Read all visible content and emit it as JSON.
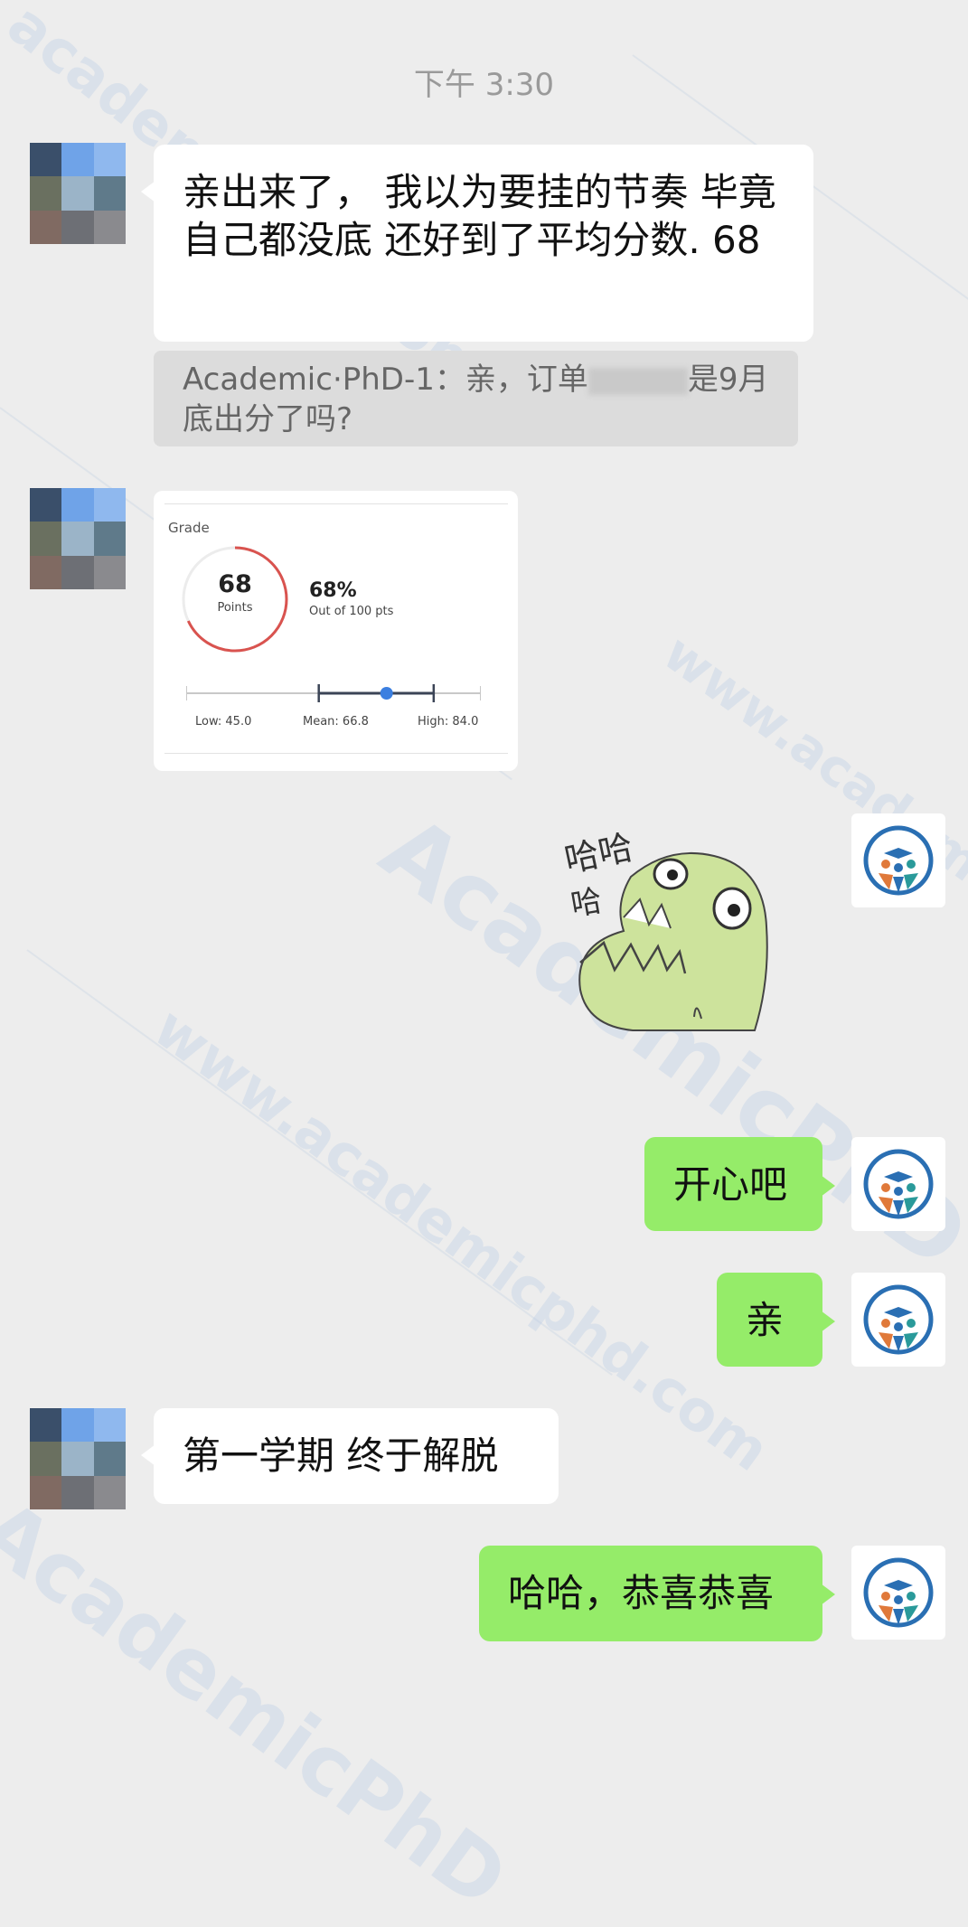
{
  "timestamp": "下午 3:30",
  "watermark": {
    "text_a": "academicphd.com",
    "text_b": "www.academicphd.com",
    "text_c": "AcademicPhD"
  },
  "colors": {
    "green_bubble": "#95ec69",
    "background": "#ededed",
    "ring_red": "#d9534f",
    "slider_dot": "#3b7fe0"
  },
  "messages": [
    {
      "sender": "other",
      "text": "亲出来了， 我以为要挂的节奏 毕竟自己都没底 还好到了平均分数. 68"
    },
    {
      "sender": "other",
      "quote_prefix": "Academic·PhD-1：亲，订单",
      "quote_suffix": "是9月底出分了吗?"
    },
    {
      "sender": "other",
      "type": "grade_card"
    },
    {
      "sender": "me",
      "type": "sticker",
      "sticker_text": [
        "哈哈",
        "哈"
      ]
    },
    {
      "sender": "me",
      "text": "开心吧"
    },
    {
      "sender": "me",
      "text": "亲"
    },
    {
      "sender": "other",
      "text": "第一学期 终于解脱"
    },
    {
      "sender": "me",
      "text": "哈哈，恭喜恭喜"
    }
  ],
  "grade": {
    "label": "Grade",
    "points": "68",
    "points_label": "Points",
    "percent": "68%",
    "out_of": "Out of 100 pts",
    "score": 68,
    "max": 100,
    "low": 45.0,
    "mean": 66.8,
    "high": 84.0,
    "low_label": "Low: 45.0",
    "mean_label": "Mean: 66.8",
    "high_label": "High: 84.0"
  },
  "icons": {
    "my_avatar": "academicphd-logo-icon",
    "other_avatar": "pixelated-avatar-icon"
  }
}
